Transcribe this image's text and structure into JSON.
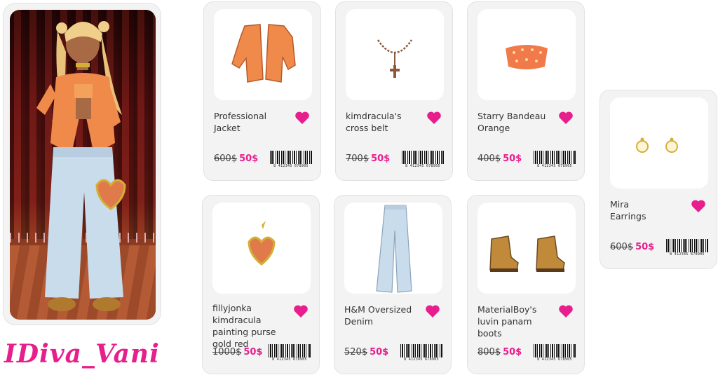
{
  "username": "IDiva_Vani",
  "colors": {
    "accent": "#e81e8c",
    "card_bg": "#f3f3f3"
  },
  "products": [
    {
      "name_lines": [
        "Professional",
        "Jacket"
      ],
      "old_price": "600$",
      "new_price": "50$",
      "barcode": "8 412345 678905"
    },
    {
      "name_lines": [
        "kimdracula's",
        "cross belt"
      ],
      "old_price": "700$",
      "new_price": "50$",
      "barcode": "8 412345 678905"
    },
    {
      "name_lines": [
        "Starry Bandeau",
        "Orange"
      ],
      "old_price": "400$",
      "new_price": "50$",
      "barcode": "8 412345 678905"
    },
    {
      "name_lines": [
        "fillyjonka kimdracula",
        "painting purse",
        "gold red"
      ],
      "old_price": "1000$",
      "new_price": "50$",
      "barcode": "8 412345 678905"
    },
    {
      "name_lines": [
        "H&M Oversized",
        "Denim"
      ],
      "old_price": "520$",
      "new_price": "50$",
      "barcode": "8 412345 678905"
    },
    {
      "name_lines": [
        "MaterialBoy's",
        "luvin panam boots"
      ],
      "old_price": "800$",
      "new_price": "50$",
      "barcode": "8 412345 678905"
    },
    {
      "name_lines": [
        "Mira",
        "Earrings"
      ],
      "old_price": "600$",
      "new_price": "50$",
      "barcode": "8 412345 678905"
    }
  ],
  "icons": {
    "favorite": "heart-icon"
  }
}
